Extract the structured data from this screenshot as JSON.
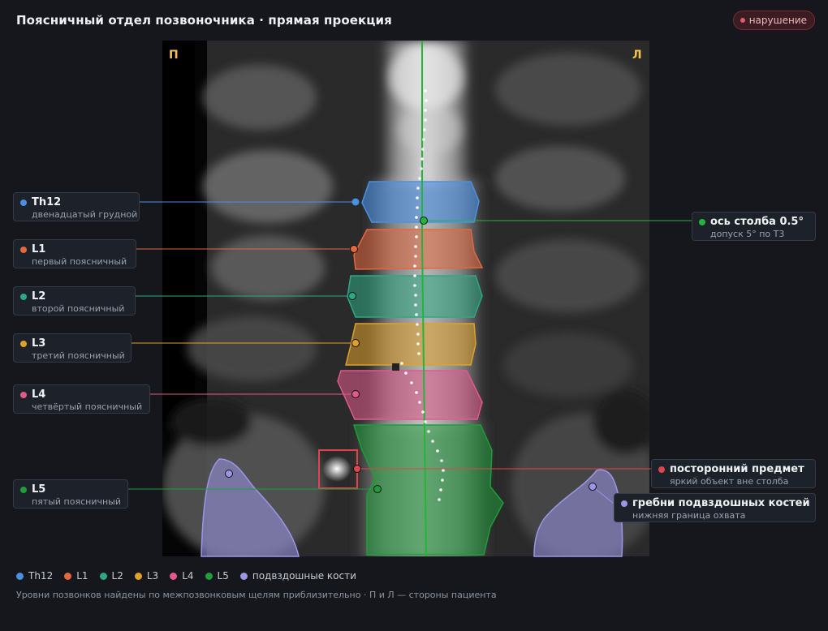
{
  "header": {
    "title": "Поясничный отдел позвоночника · прямая проекция",
    "status_badge": "нарушение"
  },
  "image": {
    "side_left": "П",
    "side_right": "Л"
  },
  "vertebrae": [
    {
      "id": "th12",
      "name": "Th12",
      "desc": "двенадцатый грудной",
      "color": "#4a90e2"
    },
    {
      "id": "l1",
      "name": "L1",
      "desc": "первый поясничный",
      "color": "#e4683e"
    },
    {
      "id": "l2",
      "name": "L2",
      "desc": "второй поясничный",
      "color": "#2ea884"
    },
    {
      "id": "l3",
      "name": "L3",
      "desc": "третий поясничный",
      "color": "#e0a12a"
    },
    {
      "id": "l4",
      "name": "L4",
      "desc": "четвёртый поясничный",
      "color": "#e25a8a"
    },
    {
      "id": "l5",
      "name": "L5",
      "desc": "пятый поясничный",
      "color": "#1f9d3a"
    }
  ],
  "axis_callout": {
    "name": "ось столба 0.5°",
    "desc": "допуск 5° по Т3",
    "color": "#22b53a"
  },
  "foreign_callout": {
    "name": "посторонний предмет",
    "desc": "яркий объект вне столба",
    "color": "#e0444e"
  },
  "iliac_callout": {
    "name": "гребни подвздошных костей",
    "desc": "нижняя граница охвата",
    "color": "#9d95e8"
  },
  "legend": [
    {
      "label": "Th12",
      "color": "#4a90e2"
    },
    {
      "label": "L1",
      "color": "#e4683e"
    },
    {
      "label": "L2",
      "color": "#2ea884"
    },
    {
      "label": "L3",
      "color": "#e0a12a"
    },
    {
      "label": "L4",
      "color": "#e25a8a"
    },
    {
      "label": "L5",
      "color": "#1f9d3a"
    },
    {
      "label": "подвздошные кости",
      "color": "#9d95e8"
    }
  ],
  "footnote": "Уровни позвонков найдены по межпозвонковым щелям приблизительно · П и Л — стороны пациента"
}
